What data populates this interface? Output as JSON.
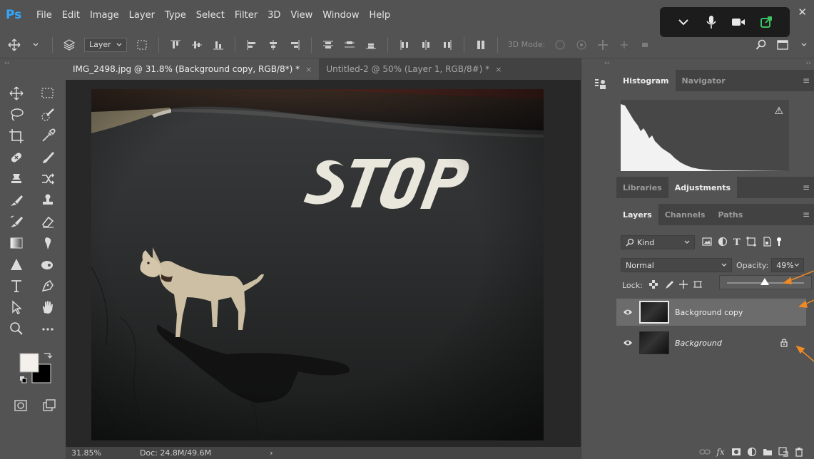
{
  "app": {
    "logo": "Ps",
    "menu": [
      "File",
      "Edit",
      "Image",
      "Layer",
      "Type",
      "Select",
      "Filter",
      "3D",
      "View",
      "Window",
      "Help"
    ],
    "close": "✕"
  },
  "options_bar": {
    "auto_select_value": "Layer",
    "mode_3d_label": "3D Mode:"
  },
  "tabs": [
    {
      "label": "IMG_2498.jpg @ 31.8% (Background copy, RGB/8*) *",
      "close": "×",
      "active": true
    },
    {
      "label": "Untitled-2 @ 50% (Layer 1, RGB/8#) *",
      "close": "×",
      "active": false
    }
  ],
  "canvas": {
    "stop_text": "STOP"
  },
  "status": {
    "zoom": "31.85%",
    "doc": "Doc: 24.8M/49.6M",
    "arrow": "›"
  },
  "panels": {
    "top_tabs": [
      "Histogram",
      "Navigator"
    ],
    "mid_tabs": [
      "Libraries",
      "Adjustments"
    ],
    "layer_tabs": [
      "Layers",
      "Channels",
      "Paths"
    ],
    "menu_glyph": "≡",
    "histogram_warning": "⚠"
  },
  "layers_panel": {
    "kind_filter": "Kind",
    "blend_mode": "Normal",
    "opacity_label": "Opacity:",
    "opacity_value": "49%",
    "opacity_fraction": 0.49,
    "lock_label": "Lock:",
    "layers": [
      {
        "name": "Background copy",
        "selected": true,
        "locked": false,
        "italic": false
      },
      {
        "name": "Background",
        "selected": false,
        "locked": true,
        "italic": true
      }
    ]
  },
  "colors": {
    "ps_blue": "#31a8ff",
    "annotation_orange": "#f08a24",
    "ui_bg": "#535353",
    "tab_bg": "#424242"
  }
}
